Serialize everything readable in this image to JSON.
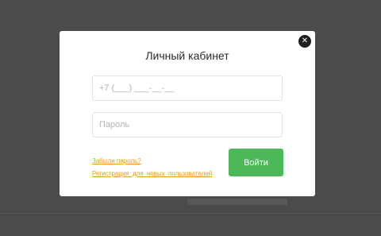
{
  "modal": {
    "title": "Личный кабинет",
    "close_label": "✕",
    "phone_placeholder": "+7 (___) ___-__-__",
    "password_placeholder": "Пароль",
    "forgot_link": "Забыли пароль?",
    "register_link": "Регистрация для новых пользователей",
    "submit_label": "Войти"
  },
  "colors": {
    "overlay": "#4b4b4b",
    "accent_button": "#4cb85a",
    "link": "#e49a2c"
  }
}
